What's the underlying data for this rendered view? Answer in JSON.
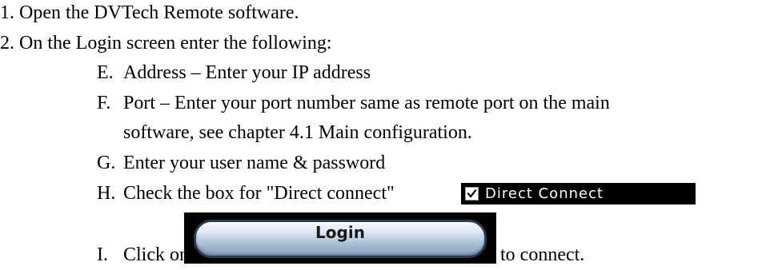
{
  "steps": [
    {
      "number": "1.",
      "text": "Open the DVTech Remote software."
    },
    {
      "number": "2.",
      "text": "On the Login screen enter the following:"
    }
  ],
  "sub_items": {
    "E": {
      "letter": "E.",
      "text": "Address – Enter your IP address"
    },
    "F": {
      "letter": "F.",
      "text": "Port – Enter your port number same as remote port on the main",
      "text2": "software, see chapter 4.1 Main configuration."
    },
    "G": {
      "letter": "G.",
      "text": "Enter your user name & password"
    },
    "H": {
      "letter": "H.",
      "text": "Check the box for \"Direct connect\""
    },
    "I": {
      "letter": "I.",
      "text": "Click on",
      "text2": "to connect."
    }
  },
  "direct_connect": {
    "label": "Direct Connect",
    "checked": true,
    "icon": "checkbox-checked-icon"
  },
  "login_button": {
    "label": "Login"
  },
  "colors": {
    "text": "#000000",
    "widget_background": "#000000",
    "button_gradient_top": "#f4f7fb",
    "button_gradient_bottom": "#8ca3bf",
    "button_border": "#2b3c52"
  }
}
